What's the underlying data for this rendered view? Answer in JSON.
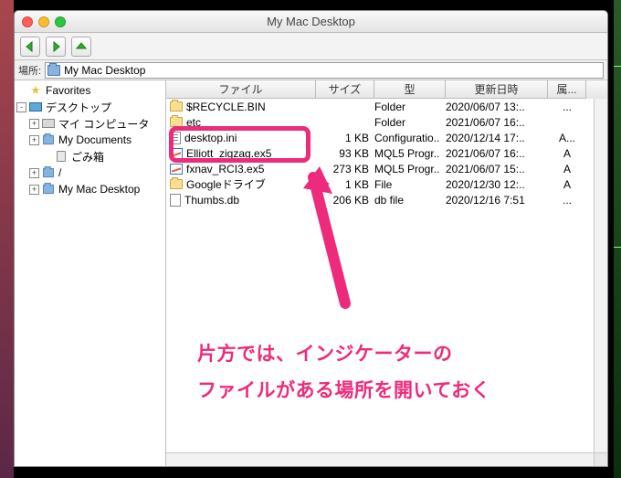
{
  "window": {
    "title": "My Mac Desktop"
  },
  "location": {
    "label": "場所:",
    "value": "My Mac Desktop"
  },
  "tree": {
    "items": [
      {
        "depth": 0,
        "exp": "",
        "icon": "star",
        "label": "Favorites"
      },
      {
        "depth": 0,
        "exp": "-",
        "icon": "desktop",
        "label": "デスクトップ"
      },
      {
        "depth": 1,
        "exp": "+",
        "icon": "computer",
        "label": "マイ コンピュータ"
      },
      {
        "depth": 1,
        "exp": "+",
        "icon": "folder",
        "label": "My Documents"
      },
      {
        "depth": 2,
        "exp": "",
        "icon": "trash",
        "label": "ごみ箱"
      },
      {
        "depth": 1,
        "exp": "+",
        "icon": "folder",
        "label": "/"
      },
      {
        "depth": 1,
        "exp": "+",
        "icon": "folder",
        "label": "My Mac Desktop"
      }
    ]
  },
  "columns": {
    "name": "ファイル",
    "size": "サイズ",
    "type": "型",
    "date": "更新日時",
    "attr": "属..."
  },
  "files": [
    {
      "icon": "folder",
      "name": "$RECYCLE.BIN",
      "size": "",
      "type": "Folder",
      "date": "2020/06/07 13:..",
      "attr": "..."
    },
    {
      "icon": "folder",
      "name": "etc",
      "size": "",
      "type": "Folder",
      "date": "2021/06/07 16:..",
      "attr": ""
    },
    {
      "icon": "ini",
      "name": "desktop.ini",
      "size": "1 KB",
      "type": "Configuratio..",
      "date": "2020/12/14 17:..",
      "attr": "A..."
    },
    {
      "icon": "ex5",
      "name": "Elliott_zigzag.ex5",
      "size": "93 KB",
      "type": "MQL5 Progr..",
      "date": "2021/06/07 16:..",
      "attr": "A"
    },
    {
      "icon": "ex5",
      "name": "fxnav_RCI3.ex5",
      "size": "273 KB",
      "type": "MQL5 Progr..",
      "date": "2021/06/07 15:..",
      "attr": "A"
    },
    {
      "icon": "folder",
      "name": "Googleドライブ",
      "size": "1 KB",
      "type": "File",
      "date": "2020/12/30 12:..",
      "attr": "A"
    },
    {
      "icon": "db",
      "name": "Thumbs.db",
      "size": "206 KB",
      "type": "db file",
      "date": "2020/12/16 7:51",
      "attr": "..."
    }
  ],
  "annotation": {
    "line1": "片方では、インジケーターの",
    "line2": "ファイルがある場所を開いておく"
  }
}
